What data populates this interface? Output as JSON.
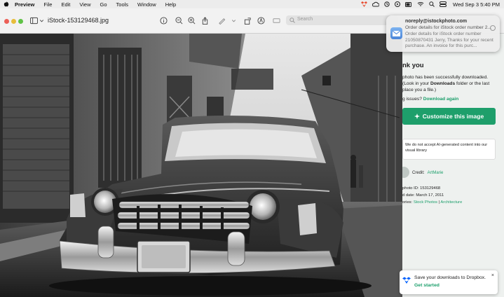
{
  "menubar": {
    "app_name": "Preview",
    "items": [
      "File",
      "Edit",
      "View",
      "Go",
      "Tools",
      "Window",
      "Help"
    ],
    "clock": "Wed Sep 3  5:40 PM"
  },
  "toolbar": {
    "document_title": "iStock-153129468.jpg",
    "search_placeholder": "Search",
    "icons": [
      "sidebar-icon",
      "info-icon",
      "zoom-out-icon",
      "zoom-in-icon",
      "share-icon",
      "markup-icon",
      "rotate-icon",
      "highlight-icon",
      "crop-icon"
    ]
  },
  "notification": {
    "sender": "noreply@istockphoto.com",
    "subject": "Order details for iStock order number 2...",
    "body": "Order details for iStock order number 21050870431 Jerry, Thanks for your recent purchase. An invoice for this purc..."
  },
  "webpage": {
    "heading": "nk you",
    "paragraph_pre": "photo has been successfully downloaded. (Look in your ",
    "paragraph_bold": "Downloads",
    "paragraph_post": " folder or the last place you a file.)",
    "issues_label": "g issues?",
    "download_again": "Download again",
    "customize_button": "Customize this image",
    "ai_notice": "We do not accept AI-generated content into our visual library",
    "credit_label": "Credit:",
    "credit_value": "ArtMarie",
    "photo_id": "photo ID: 153129468",
    "upload_date": "d date: March 17, 2011",
    "collection_label": "ories:",
    "collection_1": "Stock Photos",
    "collection_2": "Architecture"
  },
  "dropbox": {
    "message": "Save your downloads to Dropbox.",
    "cta": "Get started",
    "close": "×"
  },
  "colors": {
    "accent": "#1e9f6b",
    "menubar": "#ececec"
  }
}
